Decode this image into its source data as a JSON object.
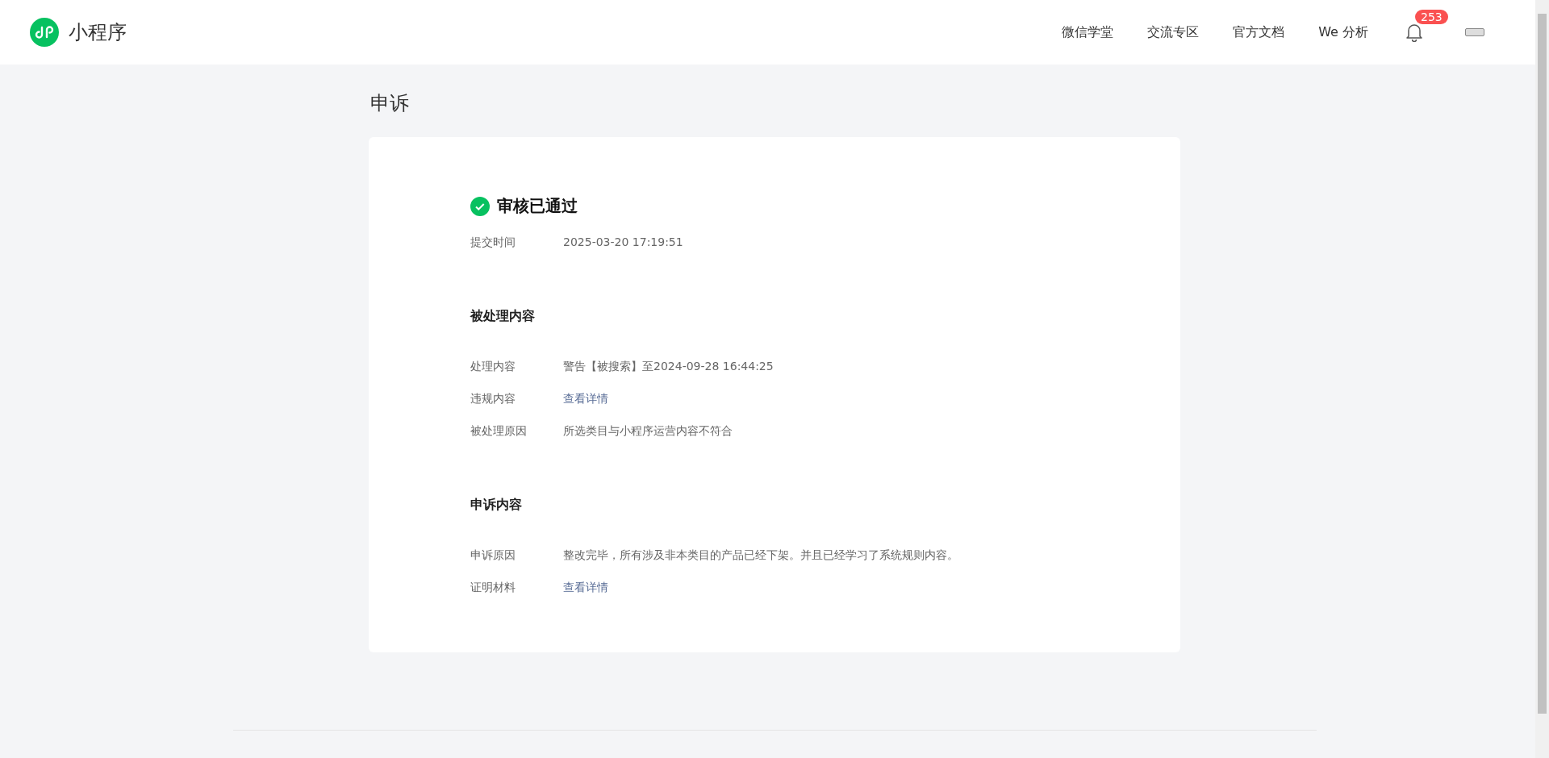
{
  "header": {
    "logo_text": "小程序",
    "nav": [
      "微信学堂",
      "交流专区",
      "官方文档",
      "We 分析"
    ],
    "notification_count": "253"
  },
  "page_title": "申诉",
  "status": {
    "kind": "approved",
    "text": "审核已通过"
  },
  "summary_rows": [
    {
      "label": "提交时间",
      "value": "2025-03-20 17:19:51",
      "kind": "text"
    }
  ],
  "sections": [
    {
      "title": "被处理内容",
      "rows": [
        {
          "label": "处理内容",
          "value": "警告【被搜索】至2024-09-28 16:44:25",
          "kind": "text"
        },
        {
          "label": "违规内容",
          "value": "查看详情",
          "kind": "link"
        },
        {
          "label": "被处理原因",
          "value": "所选类目与小程序运营内容不符合",
          "kind": "text"
        }
      ]
    },
    {
      "title": "申诉内容",
      "rows": [
        {
          "label": "申诉原因",
          "value": "整改完毕，所有涉及非本类目的产品已经下架。并且已经学习了系统规则内容。",
          "kind": "text"
        },
        {
          "label": "证明材料",
          "value": "查看详情",
          "kind": "link"
        }
      ]
    }
  ]
}
